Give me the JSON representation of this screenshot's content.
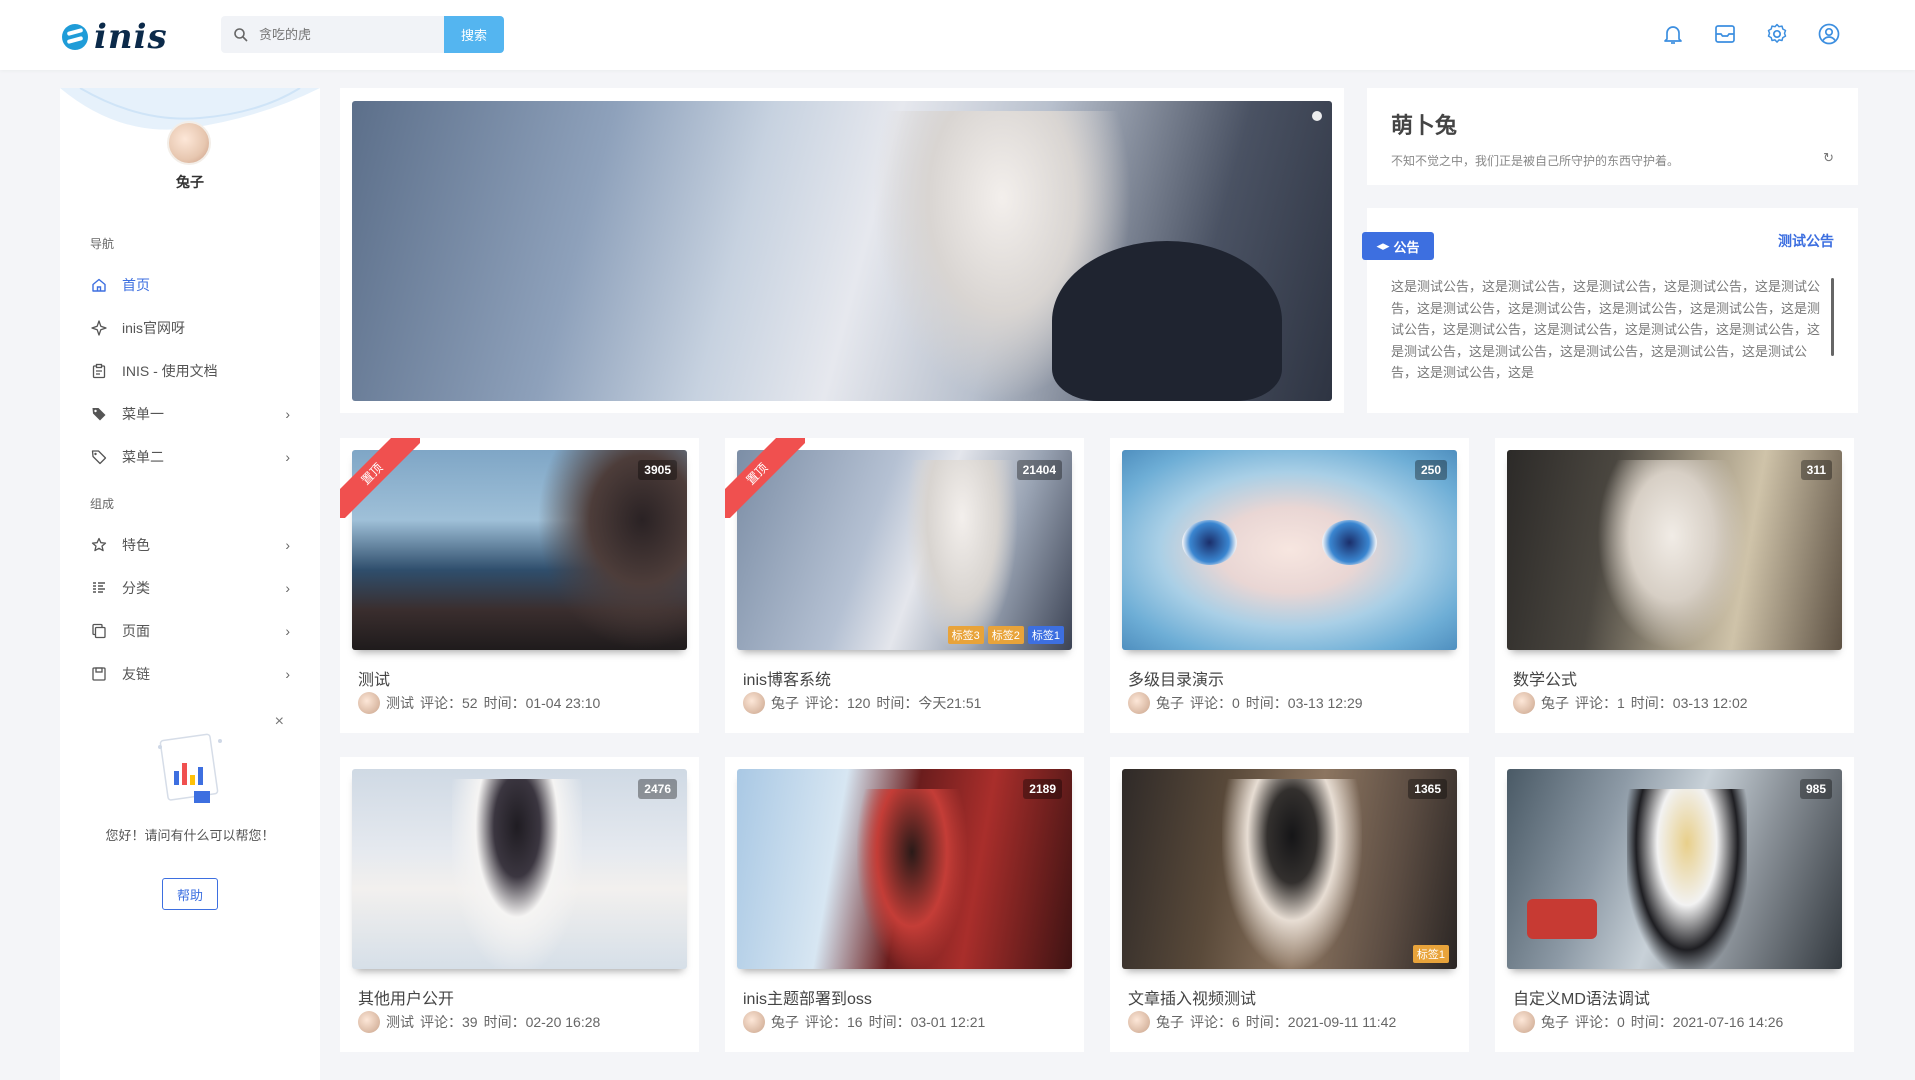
{
  "header": {
    "logo_text": "inis",
    "search_placeholder": "贪吃的虎",
    "search_button": "搜索"
  },
  "sidebar": {
    "username": "兔子",
    "section_nav": "导航",
    "section_group": "组成",
    "items": [
      {
        "label": "首页",
        "icon": "home-icon"
      },
      {
        "label": "inis官网呀",
        "icon": "star-icon"
      },
      {
        "label": "INIS - 使用文档",
        "icon": "clipboard-icon"
      },
      {
        "label": "菜单一",
        "icon": "tags-icon"
      },
      {
        "label": "菜单二",
        "icon": "tag-icon"
      },
      {
        "label": "特色",
        "icon": "star-outline-icon"
      },
      {
        "label": "分类",
        "icon": "list-icon"
      },
      {
        "label": "页面",
        "icon": "copy-icon"
      },
      {
        "label": "友链",
        "icon": "save-icon"
      }
    ],
    "help": {
      "text": "您好！请问有什么可以帮您！",
      "button": "帮助"
    }
  },
  "quote": {
    "title": "萌卜兔",
    "text": "不知不觉之中，我们正是被自己所守护的东西守护着。"
  },
  "notice": {
    "tag": "公告",
    "link": "测试公告",
    "body": "这是测试公告，这是测试公告，这是测试公告，这是测试公告，这是测试公告，这是测试公告，这是测试公告，这是测试公告，这是测试公告，这是测试公告，这是测试公告，这是测试公告，这是测试公告，这是测试公告，这是测试公告，这是测试公告，这是测试公告，这是测试公告，这是测试公告，这是测试公告，这是"
  },
  "posts": [
    {
      "title": "测试",
      "author": "测试",
      "comments": "评论：52",
      "time": "时间：01-04 23:10",
      "views": "3905",
      "pinned": "置顶"
    },
    {
      "title": "inis博客系统",
      "author": "兔子",
      "comments": "评论：120",
      "time": "时间：今天21:51",
      "views": "21404",
      "pinned": "置顶",
      "tags": [
        "标签3",
        "标签2",
        "标签1"
      ]
    },
    {
      "title": "多级目录演示",
      "author": "兔子",
      "comments": "评论：0",
      "time": "时间：03-13 12:29",
      "views": "250"
    },
    {
      "title": "数学公式",
      "author": "兔子",
      "comments": "评论：1",
      "time": "时间：03-13 12:02",
      "views": "311"
    },
    {
      "title": "其他用户公开",
      "author": "测试",
      "comments": "评论：39",
      "time": "时间：02-20 16:28",
      "views": "2476"
    },
    {
      "title": "inis主题部署到oss",
      "author": "兔子",
      "comments": "评论：16",
      "time": "时间：03-01 12:21",
      "views": "2189"
    },
    {
      "title": "文章插入视频测试",
      "author": "兔子",
      "comments": "评论：6",
      "time": "时间：2021-09-11 11:42",
      "views": "1365",
      "tags": [
        "标签1"
      ]
    },
    {
      "title": "自定义MD语法调试",
      "author": "兔子",
      "comments": "评论：0",
      "time": "时间：2021-07-16 14:26",
      "views": "985"
    }
  ]
}
